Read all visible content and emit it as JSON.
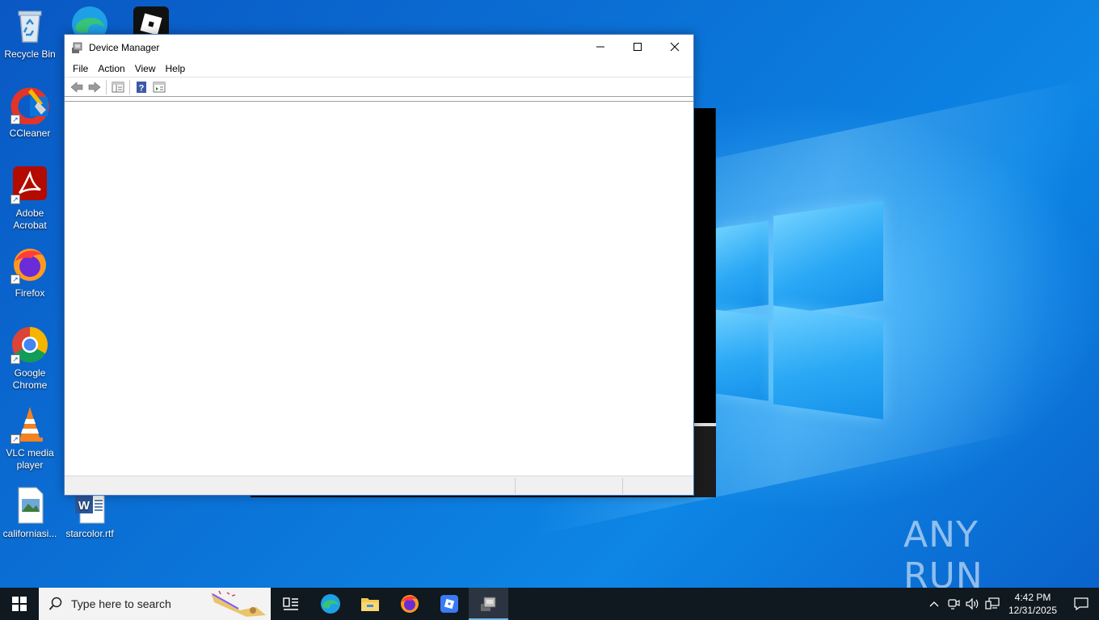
{
  "desktop": {
    "icons": [
      {
        "label": "Recycle Bin"
      },
      {
        "label": "CCleaner"
      },
      {
        "label": "Adobe Acrobat"
      },
      {
        "label": "Firefox"
      },
      {
        "label": "Google Chrome"
      },
      {
        "label": "VLC media player"
      },
      {
        "label": "californiasi..."
      },
      {
        "label": "starcolor.rtf"
      }
    ],
    "watermark": "ANY RUN"
  },
  "window": {
    "title": "Device Manager",
    "menu": [
      {
        "label": "File"
      },
      {
        "label": "Action"
      },
      {
        "label": "View"
      },
      {
        "label": "Help"
      }
    ],
    "toolbar": [
      "back-arrow-icon",
      "forward-arrow-icon",
      "show-hide-console-tree-icon",
      "help-icon",
      "properties-icon"
    ]
  },
  "taskbar": {
    "search_placeholder": "Type here to search",
    "apps": [
      "task-view-icon",
      "edge-icon",
      "file-explorer-icon",
      "firefox-icon",
      "roblox-icon",
      "device-manager-icon"
    ],
    "clock": {
      "time": "4:42 PM",
      "date": "12/31/2025"
    }
  },
  "colors": {
    "taskbar": "#101820",
    "accent": "#0a6fd1",
    "window_border": "#4a7bc4"
  }
}
